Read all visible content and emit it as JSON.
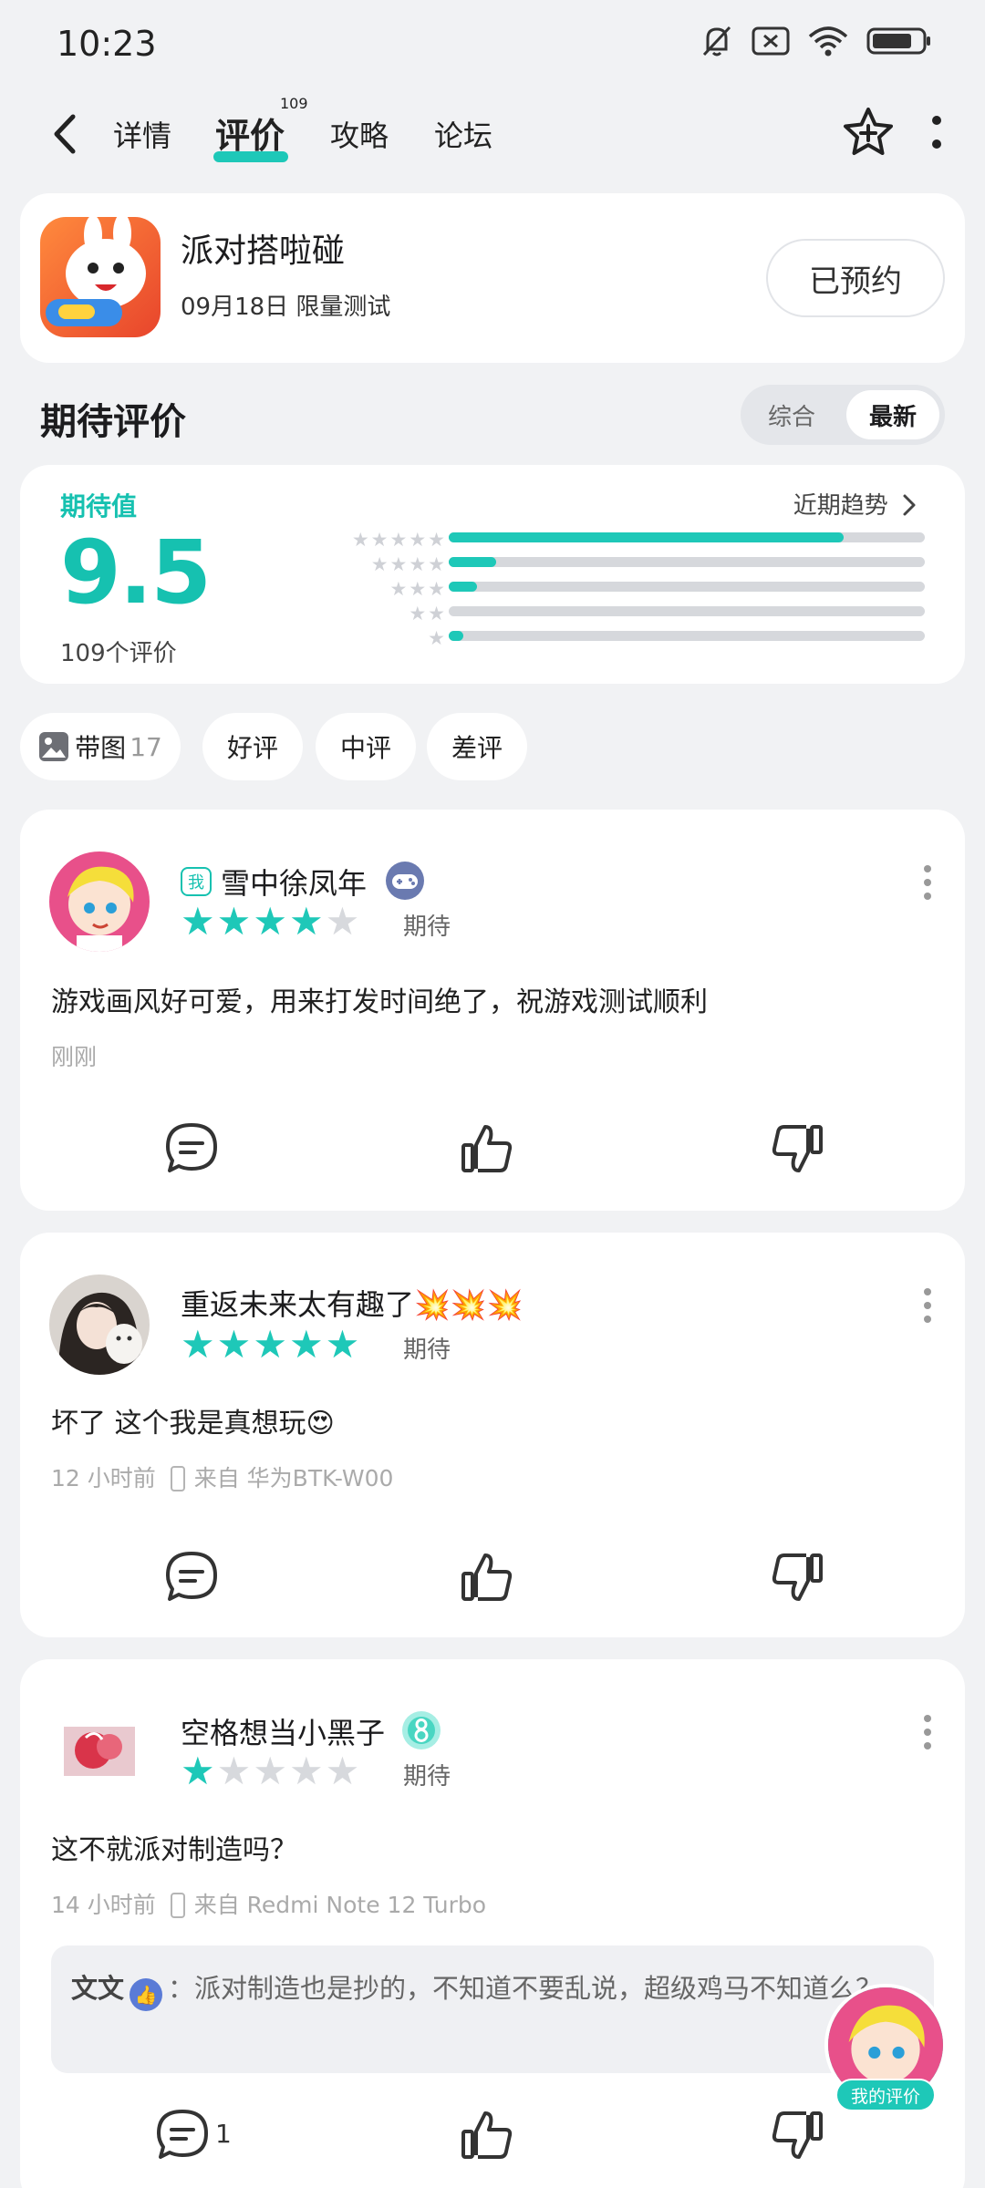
{
  "status_bar": {
    "time": "10:23"
  },
  "nav": {
    "tabs": [
      {
        "label": "详情"
      },
      {
        "label": "评价",
        "badge": "109"
      },
      {
        "label": "攻略"
      },
      {
        "label": "论坛"
      }
    ],
    "active_tab": "评价",
    "accent_color": "#1ec8b8"
  },
  "game": {
    "name": "派对搭啦碰",
    "subtitle": "09月18日 限量测试",
    "reserve_label": "已预约"
  },
  "section": {
    "title": "期待评价",
    "sort_options": [
      "综合",
      "最新"
    ],
    "sort_selected": "最新"
  },
  "rating": {
    "label": "期待值",
    "score": "9.5",
    "count_text": "109个评价",
    "trend_label": "近期趋势",
    "distribution": [
      {
        "stars": 5,
        "fraction": 0.83
      },
      {
        "stars": 4,
        "fraction": 0.1
      },
      {
        "stars": 3,
        "fraction": 0.06
      },
      {
        "stars": 2,
        "fraction": 0.0
      },
      {
        "stars": 1,
        "fraction": 0.03
      }
    ]
  },
  "filters": [
    {
      "label": "带图",
      "count": "17",
      "icon": "image-icon"
    },
    {
      "label": "好评"
    },
    {
      "label": "中评"
    },
    {
      "label": "差评"
    }
  ],
  "reviews": [
    {
      "is_me": true,
      "me_tag": "我",
      "username": "雪中徐凤年",
      "badge_icon": "gamepad-icon",
      "stars": 4,
      "tag": "期待",
      "text": "游戏画风好可爱，用来打发时间绝了，祝游戏测试顺利",
      "time": "刚刚"
    },
    {
      "username": "重返未来太有趣了💥💥💥",
      "stars": 5,
      "tag": "期待",
      "text": "坏了 这个我是真想玩😍",
      "time": "12 小时前",
      "device": "来自 华为BTK-W00"
    },
    {
      "username": "空格想当小黑子",
      "badge_icon": "level-8-icon",
      "stars": 1,
      "tag": "期待",
      "text": "这不就派对制造吗？",
      "time": "14 小时前",
      "device": "来自 Redmi Note 12 Turbo",
      "reply": {
        "author": "文文",
        "text": "：派对制造也是抄的，不知道不要乱说，超级鸡马不知道么？"
      },
      "comment_count": "1"
    }
  ],
  "fab": {
    "label": "我的评价"
  }
}
